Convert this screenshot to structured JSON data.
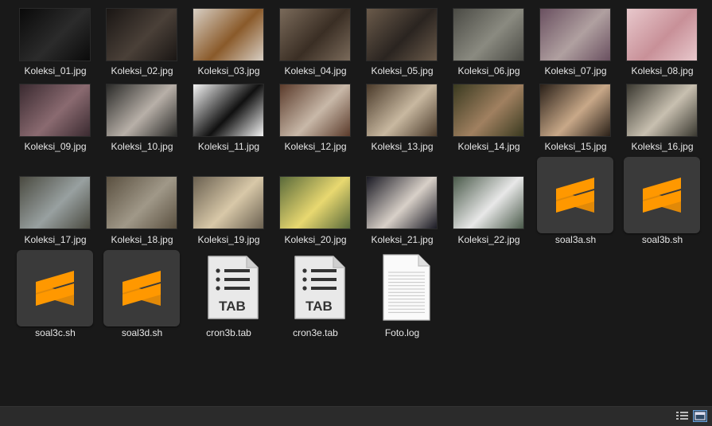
{
  "files": [
    {
      "name": "Koleksi_01.jpg",
      "kind": "image"
    },
    {
      "name": "Koleksi_02.jpg",
      "kind": "image"
    },
    {
      "name": "Koleksi_03.jpg",
      "kind": "image"
    },
    {
      "name": "Koleksi_04.jpg",
      "kind": "image"
    },
    {
      "name": "Koleksi_05.jpg",
      "kind": "image"
    },
    {
      "name": "Koleksi_06.jpg",
      "kind": "image"
    },
    {
      "name": "Koleksi_07.jpg",
      "kind": "image"
    },
    {
      "name": "Koleksi_08.jpg",
      "kind": "image"
    },
    {
      "name": "Koleksi_09.jpg",
      "kind": "image"
    },
    {
      "name": "Koleksi_10.jpg",
      "kind": "image"
    },
    {
      "name": "Koleksi_11.jpg",
      "kind": "image"
    },
    {
      "name": "Koleksi_12.jpg",
      "kind": "image"
    },
    {
      "name": "Koleksi_13.jpg",
      "kind": "image"
    },
    {
      "name": "Koleksi_14.jpg",
      "kind": "image"
    },
    {
      "name": "Koleksi_15.jpg",
      "kind": "image"
    },
    {
      "name": "Koleksi_16.jpg",
      "kind": "image"
    },
    {
      "name": "Koleksi_17.jpg",
      "kind": "image"
    },
    {
      "name": "Koleksi_18.jpg",
      "kind": "image"
    },
    {
      "name": "Koleksi_19.jpg",
      "kind": "image"
    },
    {
      "name": "Koleksi_20.jpg",
      "kind": "image"
    },
    {
      "name": "Koleksi_21.jpg",
      "kind": "image"
    },
    {
      "name": "Koleksi_22.jpg",
      "kind": "image"
    },
    {
      "name": "soal3a.sh",
      "kind": "script"
    },
    {
      "name": "soal3b.sh",
      "kind": "script"
    },
    {
      "name": "soal3c.sh",
      "kind": "script"
    },
    {
      "name": "soal3d.sh",
      "kind": "script"
    },
    {
      "name": "cron3b.tab",
      "kind": "tab"
    },
    {
      "name": "cron3e.tab",
      "kind": "tab"
    },
    {
      "name": "Foto.log",
      "kind": "log"
    }
  ],
  "tab_icon_text": "TAB",
  "icons": {
    "script": "sublime-text-icon",
    "tab": "tab-file-icon",
    "log": "text-document-icon",
    "details_view": "details-view-icon",
    "large_icons_view": "large-icons-view-icon"
  },
  "colors": {
    "background": "#191919",
    "label": "#e6e6e6",
    "sublime_orange": "#ff9800",
    "app_tile": "#3a3a3a",
    "status_bar": "#2b2b2b"
  }
}
